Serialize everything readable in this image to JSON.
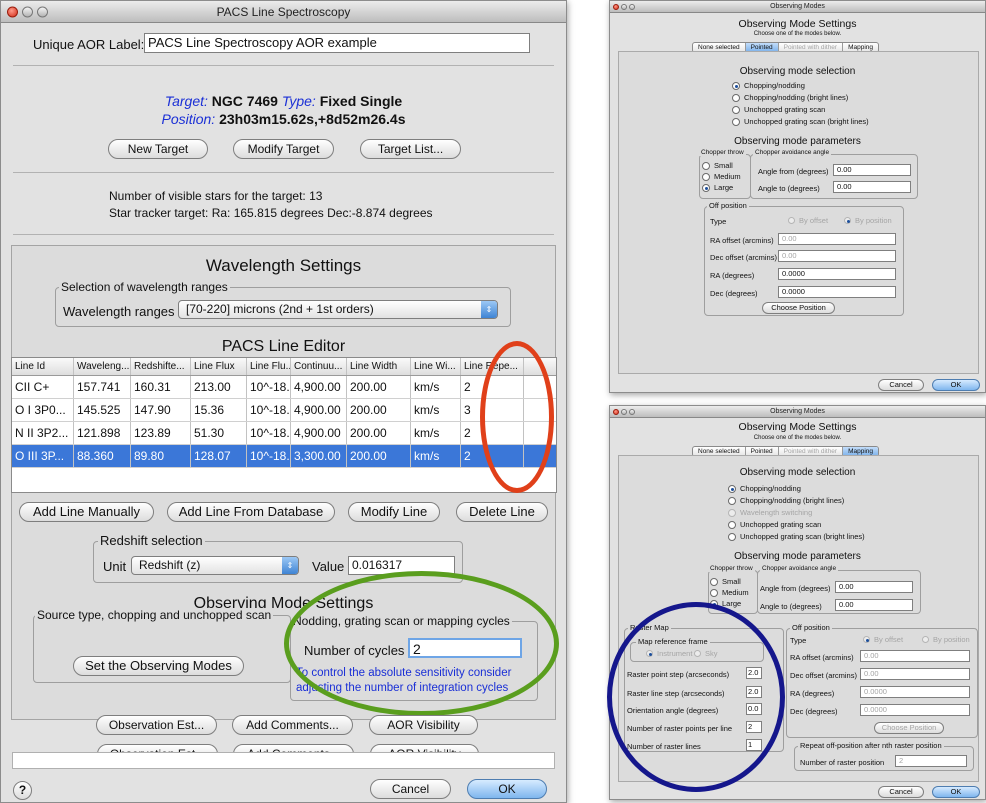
{
  "main": {
    "title": "PACS Line Spectroscopy",
    "aor_label": "Unique AOR Label:",
    "aor_value": "PACS Line Spectroscopy AOR example",
    "target": {
      "label": "Target:",
      "value": "NGC 7469",
      "type_label": "Type:",
      "type_value": "Fixed Single",
      "pos_label": "Position:",
      "pos_value": "23h03m15.62s,+8d52m26.4s"
    },
    "target_buttons": {
      "new": "New Target",
      "modify": "Modify Target",
      "list": "Target List..."
    },
    "visible_stars": "Number of visible stars for the target: 13",
    "star_tracker": "Star tracker target: Ra: 165.815 degrees Dec:-8.874 degrees",
    "wavelength": {
      "title": "Wavelength Settings",
      "group": "Selection of wavelength ranges",
      "label": "Wavelength ranges",
      "value": "[70-220] microns (2nd + 1st orders)"
    },
    "editor": {
      "title": "PACS Line Editor",
      "columns": [
        "Line Id",
        "Waveleng...",
        "Redshifte...",
        "Line Flux",
        "Line Flu...",
        "Continuu...",
        "Line Width",
        "Line Wi...",
        "Line Repe..."
      ],
      "rows": [
        [
          "CII C+",
          "157.741",
          "160.31",
          "213.00",
          "10^-18...",
          "4,900.00",
          "200.00",
          "km/s",
          "2"
        ],
        [
          "O I 3P0...",
          "145.525",
          "147.90",
          "15.36",
          "10^-18...",
          "4,900.00",
          "200.00",
          "km/s",
          "3"
        ],
        [
          "N II 3P2...",
          "121.898",
          "123.89",
          "51.30",
          "10^-18...",
          "4,900.00",
          "200.00",
          "km/s",
          "2"
        ],
        [
          "O III 3P...",
          "88.360",
          "89.80",
          "128.07",
          "10^-18...",
          "3,300.00",
          "200.00",
          "km/s",
          "2"
        ]
      ]
    },
    "line_buttons": {
      "add_manual": "Add Line Manually",
      "add_db": "Add Line From Database",
      "modify": "Modify Line",
      "delete": "Delete Line"
    },
    "redshift": {
      "group": "Redshift selection",
      "unit_label": "Unit",
      "unit_value": "Redshift (z)",
      "value_label": "Value",
      "value": "0.016317"
    },
    "obs_mode": {
      "title": "Observing Mode Settings",
      "source_group": "Source type, chopping and unchopped scan",
      "set_button": "Set the Observing Modes",
      "cycles_group": "Nodding, grating scan or mapping cycles",
      "cycles_label": "Number of cycles",
      "cycles_value": "2",
      "note": "To control the absolute sensitivity consider adjusting the number of integration cycles"
    },
    "bottom_buttons": {
      "est": "Observation Est...",
      "comments": "Add Comments...",
      "visibility": "AOR Visibility"
    },
    "help": "?",
    "cancel": "Cancel",
    "ok": "OK"
  },
  "top_dialog": {
    "title": "Observing Modes",
    "heading": "Observing Mode Settings",
    "sub": "Choose one of the modes below.",
    "tabs": [
      "None selected",
      "Pointed",
      "Pointed with dither",
      "Mapping"
    ],
    "selection_title": "Observing mode selection",
    "modes": [
      "Chopping/nodding",
      "Chopping/nodding (bright lines)",
      "Unchopped grating scan",
      "Unchopped grating scan (bright lines)"
    ],
    "params_title": "Observing mode parameters",
    "chopper_throw": {
      "group": "Chopper throw",
      "options": [
        "Small",
        "Medium",
        "Large"
      ]
    },
    "avoidance": {
      "group": "Chopper avoidance angle",
      "from_label": "Angle from (degrees)",
      "from_value": "0.00",
      "to_label": "Angle to (degrees)",
      "to_value": "0.00"
    },
    "off_position": {
      "group": "Off position",
      "type_label": "Type",
      "by_offset": "By offset",
      "by_position": "By position",
      "ra_off_label": "RA offset (arcmins)",
      "ra_off_value": "0.00",
      "dec_off_label": "Dec offset (arcmins)",
      "dec_off_value": "0.00",
      "ra_label": "RA (degrees)",
      "ra_value": "0.0000",
      "dec_label": "Dec (degrees)",
      "dec_value": "0.0000",
      "choose": "Choose Position"
    },
    "cancel": "Cancel",
    "ok": "OK"
  },
  "bottom_dialog": {
    "title": "Observing Modes",
    "heading": "Observing Mode Settings",
    "sub": "Choose one of the modes below.",
    "tabs": [
      "None selected",
      "Pointed",
      "Pointed with dither",
      "Mapping"
    ],
    "selection_title": "Observing mode selection",
    "modes": [
      "Chopping/nodding",
      "Chopping/nodding (bright lines)",
      "Wavelength switching",
      "Unchopped grating scan",
      "Unchopped grating scan (bright lines)"
    ],
    "params_title": "Observing mode parameters",
    "chopper_throw": {
      "group": "Chopper throw",
      "options": [
        "Small",
        "Medium",
        "Large"
      ]
    },
    "avoidance": {
      "group": "Chopper avoidance angle",
      "from_label": "Angle from (degrees)",
      "from_value": "0.00",
      "to_label": "Angle to (degrees)",
      "to_value": "0.00"
    },
    "raster": {
      "group": "Raster Map",
      "frame_group": "Map reference frame",
      "instrument": "Instrument",
      "sky": "Sky",
      "point_step_label": "Raster point step (arcseconds)",
      "point_step": "2.0",
      "line_step_label": "Raster line step (arcseconds)",
      "line_step": "2.0",
      "orient_label": "Orientation angle (degrees)",
      "orient": "0.0",
      "points_label": "Number of raster points per line",
      "points": "2",
      "lines_label": "Number of raster lines",
      "lines": "1"
    },
    "off_position": {
      "group": "Off position",
      "type_label": "Type",
      "by_offset": "By offset",
      "by_position": "By position",
      "ra_off_label": "RA offset (arcmins)",
      "ra_off_value": "0.00",
      "dec_off_label": "Dec offset (arcmins)",
      "dec_off_value": "0.00",
      "ra_label": "RA (degrees)",
      "ra_value": "0.0000",
      "dec_label": "Dec (degrees)",
      "dec_value": "0.0000",
      "choose": "Choose Position"
    },
    "repeat": {
      "group": "Repeat off-position after nth raster position",
      "label": "Number of raster position",
      "value": "2"
    },
    "cancel": "Cancel",
    "ok": "OK"
  },
  "colors": {
    "target_blue": "#1a2fd6",
    "selected_row": "#3b77d8",
    "ring_red": "#e0401a",
    "ring_green": "#5a9e1e",
    "ring_navy": "#15178c"
  }
}
